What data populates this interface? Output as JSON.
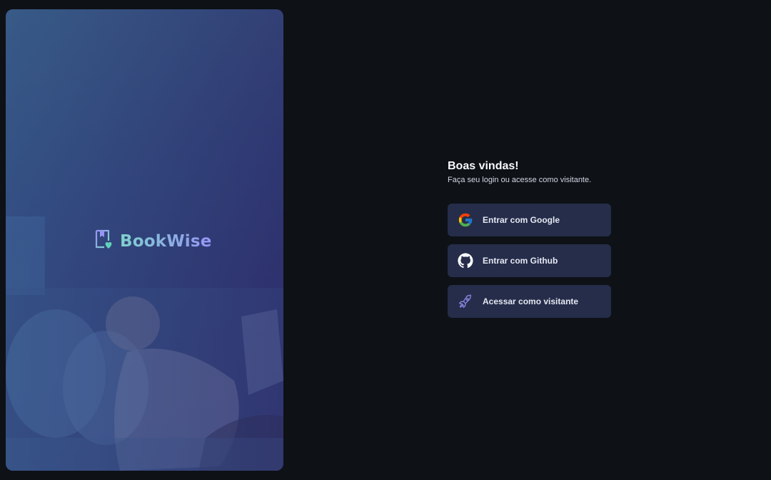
{
  "brand": {
    "name": "BookWise",
    "logo_icon": "book-heart-icon"
  },
  "login": {
    "title": "Boas vindas!",
    "subtitle": "Faça seu login ou acesse como visitante.",
    "buttons": [
      {
        "label": "Entrar com Google",
        "icon": "google-icon"
      },
      {
        "label": "Entrar com Github",
        "icon": "github-icon"
      },
      {
        "label": "Acessar como visitante",
        "icon": "rocket-icon"
      }
    ]
  },
  "colors": {
    "background": "#0e1116",
    "button_bg": "#252d4a",
    "brand_gradient_start": "#7fd1cc",
    "brand_gradient_end": "#9694f5"
  }
}
